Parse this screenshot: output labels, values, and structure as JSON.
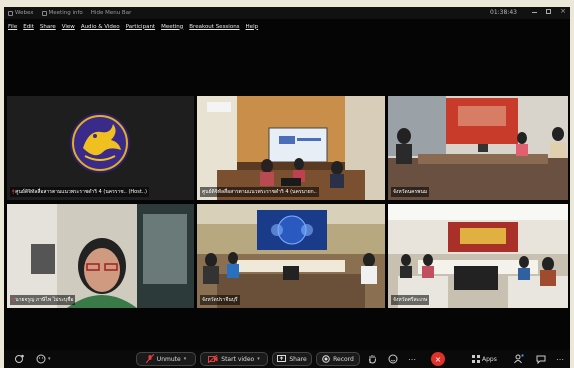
{
  "titlebar": {
    "app": "Webex",
    "meeting_info": "Meeting info",
    "hide_menu": "Hide Menu Bar",
    "timer": "01:38:43"
  },
  "menu": [
    "File",
    "Edit",
    "Share",
    "View",
    "Audio & Video",
    "Participant",
    "Meeting",
    "Breakout Sessions",
    "Help"
  ],
  "tiles": [
    {
      "label": "ศูนย์ดิจิทัลสื่อสารตามแนวพระราชดำริ 4 (นครราช.. (Host..)"
    },
    {
      "label": "ศูนย์ดิจิทัลสื่อสารตามแนวพระราชดำริ 4 (นครนายก.."
    },
    {
      "label": "จังหวัดนครพนม"
    },
    {
      "label": "นายจรูญ ภาษีไพ ไม่ระบุชื่อ"
    },
    {
      "label": "จังหวัดปราจีนบุรี"
    },
    {
      "label": "จังหวัดศรีสะเกษ"
    }
  ],
  "toolbar": {
    "unmute": "Unmute",
    "start_video": "Start video",
    "share": "Share",
    "record": "Record",
    "apps": "Apps"
  },
  "colors": {
    "accent": "#e0302a",
    "tile_bg": "#1c1c1c"
  }
}
